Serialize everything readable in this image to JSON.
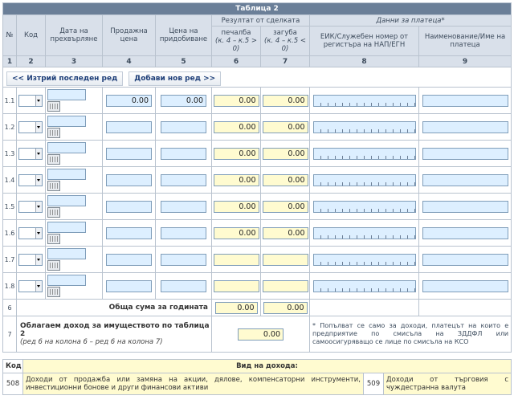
{
  "table": {
    "title": "Таблица 2",
    "headers": {
      "num": "№",
      "code": "Код",
      "date": "Дата на прехвърляне",
      "sale": "Продажна цена",
      "acq": "Цена на придобиване",
      "result": "Резултат от сделката",
      "profit": "печалба",
      "profit_sub": "(к. 4 – к.5 > 0)",
      "loss": "загуба",
      "loss_sub": "(к. 4 – к.5 < 0)",
      "payer": "Данни за платеца*",
      "eik": "ЕИК/Служебен номер от регистъра на НАП/ЕГН",
      "name": "Наименование/Име на платеца"
    },
    "colnums": [
      "1",
      "2",
      "3",
      "4",
      "5",
      "6",
      "7",
      "8",
      "9"
    ],
    "buttons": {
      "delete": "<< Изтрий последен ред",
      "add": "Добави нов ред >>"
    },
    "rows": [
      {
        "label": "1.1",
        "sale": "0.00",
        "acq": "0.00",
        "profit": "0.00",
        "loss": "0.00"
      },
      {
        "label": "1.2",
        "sale": "",
        "acq": "",
        "profit": "0.00",
        "loss": "0.00"
      },
      {
        "label": "1.3",
        "sale": "",
        "acq": "",
        "profit": "0.00",
        "loss": "0.00"
      },
      {
        "label": "1.4",
        "sale": "",
        "acq": "",
        "profit": "0.00",
        "loss": "0.00"
      },
      {
        "label": "1.5",
        "sale": "",
        "acq": "",
        "profit": "0.00",
        "loss": "0.00"
      },
      {
        "label": "1.6",
        "sale": "",
        "acq": "",
        "profit": "0.00",
        "loss": "0.00"
      },
      {
        "label": "1.7",
        "sale": "",
        "acq": "",
        "profit": "",
        "loss": ""
      },
      {
        "label": "1.8",
        "sale": "",
        "acq": "",
        "profit": "",
        "loss": ""
      }
    ],
    "total": {
      "label": "6",
      "text": "Обща сума за годината",
      "profit": "0.00",
      "loss": "0.00"
    },
    "taxable": {
      "label": "7",
      "title": "Облагаем доход за имуществото по таблица 2",
      "sub": "(ред 6 на колона 6 – ред 6 на колона 7)",
      "value": "0.00",
      "note": "* Попълват се само за доходи, платецът на които е предприятие по смисъла на ЗДДФЛ или самоосигуряващо се лице по смисъла на КСО"
    }
  },
  "kinds": {
    "code_header": "Код",
    "kind_header": "Вид на дохода:",
    "items": [
      {
        "code": "508",
        "text": "Доходи от продажба или замяна на акции, дялове, компенсаторни инструменти, инвестиционни бонове и други финансови активи"
      },
      {
        "code": "509",
        "text": "Доходи от търговия с чуждестранна валута"
      }
    ]
  },
  "colors": {
    "title_bg": "#6b7f98",
    "header_bg": "#d9e0ea",
    "input_blue": "#ddefff",
    "input_yellow": "#fffbd0"
  }
}
